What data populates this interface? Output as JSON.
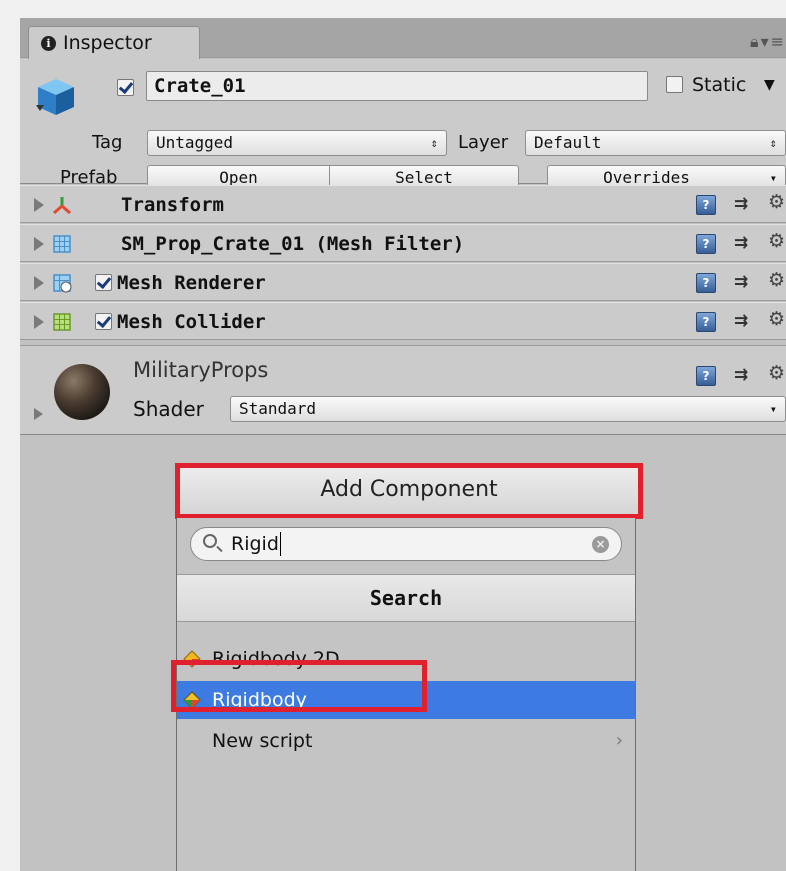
{
  "tab": {
    "label": "Inspector"
  },
  "header": {
    "object_name": "Crate_01",
    "active_checked": true,
    "static_label": "Static",
    "tag_label": "Tag",
    "tag_value": "Untagged",
    "layer_label": "Layer",
    "layer_value": "Default",
    "prefab_label": "Prefab",
    "open_label": "Open",
    "select_label": "Select",
    "overrides_label": "Overrides"
  },
  "components": [
    {
      "name": "Transform",
      "icon": "transform-icon",
      "has_checkbox": false
    },
    {
      "name": "SM_Prop_Crate_01 (Mesh Filter)",
      "icon": "mesh-filter-icon",
      "has_checkbox": false
    },
    {
      "name": "Mesh Renderer",
      "icon": "mesh-renderer-icon",
      "has_checkbox": true,
      "checked": true
    },
    {
      "name": "Mesh Collider",
      "icon": "mesh-collider-icon",
      "has_checkbox": true,
      "checked": true
    }
  ],
  "material": {
    "name": "MilitaryProps",
    "shader_label": "Shader",
    "shader_value": "Standard"
  },
  "add_component": {
    "label": "Add Component",
    "search_value": "Rigid",
    "search_header": "Search",
    "results": [
      {
        "label": "Rigidbody 2D",
        "icon": "rigidbody2d-icon",
        "selected": false
      },
      {
        "label": "Rigidbody",
        "icon": "rigidbody-icon",
        "selected": true
      },
      {
        "label": "New script",
        "selected": false,
        "has_submenu": true
      }
    ]
  },
  "colors": {
    "selection": "#3d7be3",
    "highlight_annotation": "#e0202c",
    "panel_bg": "#c2c2c2"
  }
}
